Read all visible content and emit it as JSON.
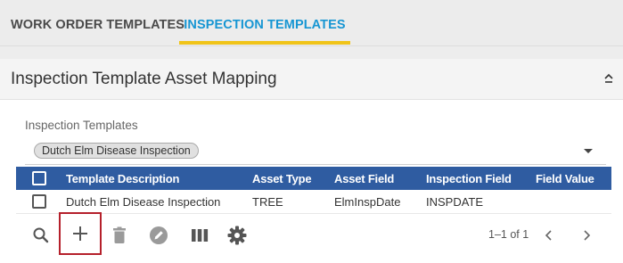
{
  "tabs": [
    {
      "label": "WORK ORDER TEMPLATES",
      "active": false
    },
    {
      "label": "INSPECTION TEMPLATES",
      "active": true
    }
  ],
  "panel": {
    "title": "Inspection Template Asset Mapping",
    "collapse_icon": "chevron-up-icon"
  },
  "filter": {
    "label": "Inspection Templates",
    "selected_chip": "Dutch Elm Disease Inspection"
  },
  "grid": {
    "columns": [
      "Template Description",
      "Asset Type",
      "Asset Field",
      "Inspection Field",
      "Field Value"
    ],
    "rows": [
      {
        "template_description": "Dutch Elm Disease Inspection",
        "asset_type": "TREE",
        "asset_field": "ElmInspDate",
        "inspection_field": "INSPDATE",
        "field_value": ""
      }
    ]
  },
  "toolbar": {
    "icons": [
      "search-icon",
      "add-icon",
      "delete-icon",
      "edit-icon",
      "columns-icon",
      "settings-icon"
    ],
    "pager_text": "1–1 of 1"
  },
  "colors": {
    "accent_blue": "#1796d3",
    "tab_underline": "#f0c419",
    "grid_header": "#2f5ca1",
    "highlight_border": "#b5202b"
  }
}
